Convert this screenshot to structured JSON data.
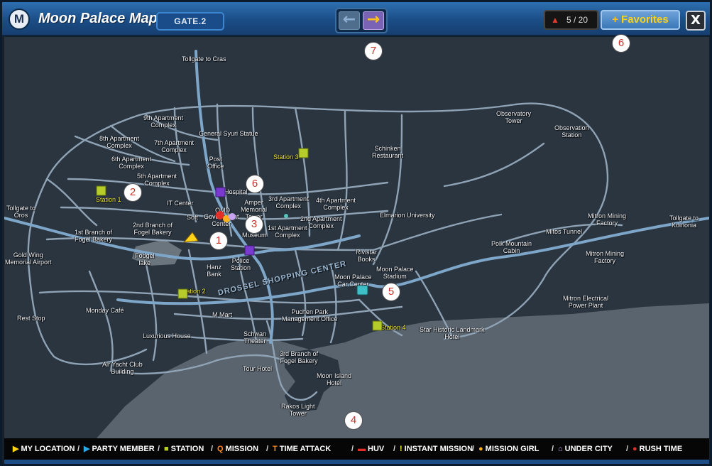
{
  "window": {
    "logo_letter": "M",
    "title": "Moon Palace Map",
    "gate": "GATE.2",
    "nav_back_glyph": "←",
    "nav_forward_glyph": "→",
    "counter": "5 / 20",
    "favorites_label": "Favorites",
    "favorites_plus": "+",
    "close_glyph": "X"
  },
  "colors": {
    "titlebar": "#1b4d86",
    "map_ground": "#2a3540",
    "sea": "#59636d",
    "road": "#93a7b8",
    "highway": "#7ea6c8",
    "station_icon": "#b6cc2a",
    "label_station": "#f4ec3a",
    "callout_number": "#c8322a"
  },
  "map_labels": {
    "tollgate_cras": "Tollgate to Cras",
    "apt9": "9th Apartment\nComplex",
    "apt8": "8th Apartment\nComplex",
    "apt7": "7th Apartment\nComplex",
    "general_syuri": "General Syuri Statue",
    "apt6": "6th Apartment\nComplex",
    "post_office": "Post\nOffice",
    "apt5": "5th Apartment\nComplex",
    "station1": "Station 1",
    "station2": "Station 2",
    "station3": "Station 3",
    "station4": "Station 4",
    "it_center": "IT Center",
    "hospital": "Hospital",
    "amper_memorial": "Amper\nMemorial\nTower",
    "apt3": "3rd Apartment\nComplex",
    "apt4": "4th Apartment\nComplex",
    "schinken": "Schinken\nRestaurant",
    "observatory_tower": "Observatory\nTower",
    "observation_station": "Observation\nStation",
    "tollgate_oros": "Tollgate to\nOros",
    "branch2_bakery": "2nd Branch of\nFogel Bakery",
    "soft": "Soft",
    "omd": "OMD",
    "gov_center": "Government\nCenter",
    "art_museum": "Art\nMuseum",
    "apt2": "2nd Apartment\nComplex",
    "apt1": "1st Apartment\nComplex",
    "elmarion": "Elmarion University",
    "mitron_mining_1": "Mitron Mining\nFactory",
    "tollgate_koinonia": "Tollgate to\nKoinonia",
    "mitos_tunnel": "Mitos Tunnel",
    "branch1_bakery": "1st Branch of\nFogel Bakery",
    "polk_cabin": "Polk Mountain\nCabin",
    "mitron_mining_2": "Mitron Mining\nFactory",
    "gold_wing": "Gold Wing\nMemorial Airport",
    "fodgel_lake": "Fodgel\nlake",
    "hanz_bank": "Hanz\nBank",
    "police_station": "Police\nStation",
    "rivistar": "Rivistar\nBooks",
    "moon_palace_stadium": "Moon Palace\nStadium",
    "drossel": "DROSSEL SHOPPING CENTER",
    "moon_palace_car": "Moon Palace\nCar Center",
    "mitron_electrical": "Mitron Electrical\nPower Plant",
    "rest_stop": "Rest Stop",
    "monday_cafe": "Monday Café",
    "mmart": "M Mart",
    "puchen_park": "Puchen Park\nManagement Office",
    "luxurious_house": "Luxurious House",
    "schwan_theater": "Schwan\nTheater",
    "star_historic": "Star Historic Landmark\nHotel",
    "branch3_bakery": "3rd Branch of\nFogel Bakery",
    "air_yacht": "Air Yacht Club\nBuilding",
    "tour_hotel": "Tour Hotel",
    "moon_island": "Moon Island\nHotel",
    "rakos_light": "Rakos Light\nTower"
  },
  "callouts": [
    "1",
    "2",
    "3",
    "4",
    "5",
    "6",
    "6",
    "7"
  ],
  "legend": [
    {
      "icon": "my-location-icon",
      "glyph": "▶",
      "color": "#ffd21a",
      "label": "MY LOCATION"
    },
    {
      "icon": "party-member-icon",
      "glyph": "▶",
      "color": "#2aa8e8",
      "label": "PARTY MEMBER"
    },
    {
      "icon": "station-icon",
      "glyph": "■",
      "color": "#b6cc2a",
      "label": "STATION"
    },
    {
      "icon": "mission-icon",
      "glyph": "Q",
      "color": "#ff8a1c",
      "label": "MISSION"
    },
    {
      "icon": "time-attack-icon",
      "glyph": "T",
      "color": "#ff8a1c",
      "label": "TIME ATTACK"
    },
    {
      "icon": "huv-icon",
      "glyph": "▬",
      "color": "#e0302a",
      "label": "HUV"
    },
    {
      "icon": "instant-mission-icon",
      "glyph": "!",
      "color": "#f4ec3a",
      "label": "INSTANT MISSION"
    },
    {
      "icon": "mission-girl-icon",
      "glyph": "●",
      "color": "#ffb01c",
      "label": "MISSION GIRL"
    },
    {
      "icon": "under-city-icon",
      "glyph": "⌂",
      "color": "#c6a4f0",
      "label": "UNDER CITY"
    },
    {
      "icon": "rush-time-icon",
      "glyph": "●",
      "color": "#e0302a",
      "label": "RUSH TIME"
    }
  ],
  "legend_separator": "/"
}
